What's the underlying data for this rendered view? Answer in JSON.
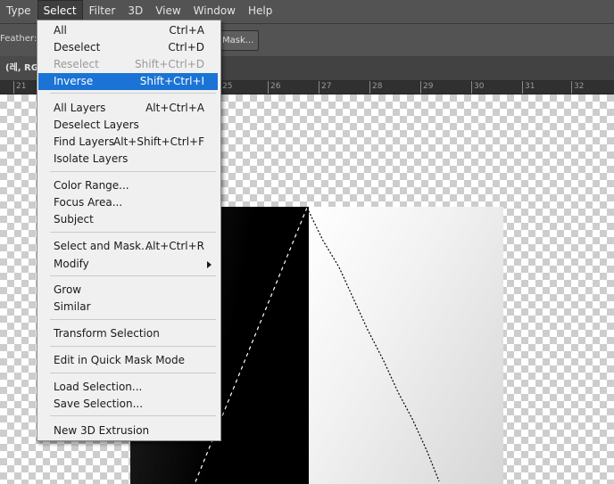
{
  "menubar": {
    "items": [
      "Type",
      "Select",
      "Filter",
      "3D",
      "View",
      "Window",
      "Help"
    ],
    "active": "Select"
  },
  "options_bar": {
    "feather_label": "Feather:",
    "mask_button_label": "Mask..."
  },
  "document_tab": {
    "label": "(레, RG"
  },
  "ruler": {
    "labels": [
      "21",
      "25",
      "26",
      "27",
      "28",
      "29",
      "30",
      "31",
      "32"
    ]
  },
  "select_menu": {
    "items": [
      {
        "label": "All",
        "shortcut": "Ctrl+A",
        "state": "normal"
      },
      {
        "label": "Deselect",
        "shortcut": "Ctrl+D",
        "state": "normal"
      },
      {
        "label": "Reselect",
        "shortcut": "Shift+Ctrl+D",
        "state": "disabled"
      },
      {
        "label": "Inverse",
        "shortcut": "Shift+Ctrl+I",
        "state": "highlighted"
      },
      {
        "label": "All Layers",
        "shortcut": "Alt+Ctrl+A",
        "state": "normal"
      },
      {
        "label": "Deselect Layers",
        "shortcut": "",
        "state": "normal"
      },
      {
        "label": "Find Layers",
        "shortcut": "Alt+Shift+Ctrl+F",
        "state": "normal"
      },
      {
        "label": "Isolate Layers",
        "shortcut": "",
        "state": "normal"
      },
      {
        "label": "Color Range...",
        "shortcut": "",
        "state": "normal"
      },
      {
        "label": "Focus Area...",
        "shortcut": "",
        "state": "normal"
      },
      {
        "label": "Subject",
        "shortcut": "",
        "state": "normal"
      },
      {
        "label": "Select and Mask...",
        "shortcut": "Alt+Ctrl+R",
        "state": "normal"
      },
      {
        "label": "Modify",
        "shortcut": "",
        "state": "submenu"
      },
      {
        "label": "Grow",
        "shortcut": "",
        "state": "normal"
      },
      {
        "label": "Similar",
        "shortcut": "",
        "state": "normal"
      },
      {
        "label": "Transform Selection",
        "shortcut": "",
        "state": "normal"
      },
      {
        "label": "Edit in Quick Mask Mode",
        "shortcut": "",
        "state": "normal"
      },
      {
        "label": "Load Selection...",
        "shortcut": "",
        "state": "normal"
      },
      {
        "label": "Save Selection...",
        "shortcut": "",
        "state": "normal"
      },
      {
        "label": "New 3D Extrusion",
        "shortcut": "",
        "state": "normal"
      }
    ]
  },
  "colors": {
    "highlight": "#1a73d5",
    "menu_bg": "#f0f0f0",
    "app_bg": "#535353"
  }
}
